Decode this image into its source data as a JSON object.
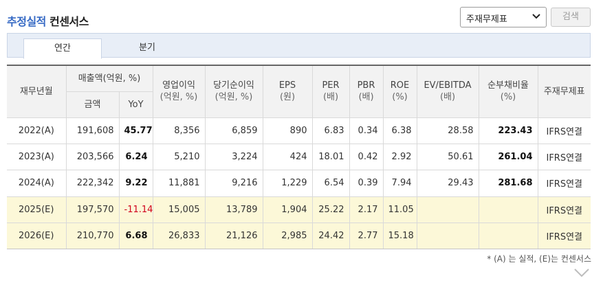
{
  "header": {
    "title_accent": "추정실적",
    "title_rest": "컨센서스",
    "select_value": "주재무제표",
    "search_label": "검색"
  },
  "tabs": [
    {
      "label": "연간",
      "active": true
    },
    {
      "label": "분기",
      "active": false
    }
  ],
  "table": {
    "headers": {
      "period": "재무년월",
      "revenue_group": "매출액(억원, %)",
      "amount": "금액",
      "yoy": "YoY",
      "op_income": "영업이익",
      "op_income_unit": "(억원, %)",
      "net_income": "당기순이익",
      "net_income_unit": "(억원, %)",
      "eps": "EPS",
      "eps_unit": "(원)",
      "per": "PER",
      "per_unit": "(배)",
      "pbr": "PBR",
      "pbr_unit": "(배)",
      "roe": "ROE",
      "roe_unit": "(%)",
      "ev_ebitda": "EV/EBITDA",
      "ev_ebitda_unit": "(배)",
      "net_debt": "순부채비율",
      "net_debt_unit": "(%)",
      "statement": "주재무제표"
    },
    "rows": [
      {
        "period": "2022(A)",
        "amount": "191,608",
        "yoy": "45.77",
        "op": "8,356",
        "net": "6,859",
        "eps": "890",
        "per": "6.83",
        "pbr": "0.34",
        "roe": "6.38",
        "ev": "28.58",
        "debt": "223.43",
        "std": "IFRS연결"
      },
      {
        "period": "2023(A)",
        "amount": "203,566",
        "yoy": "6.24",
        "op": "5,210",
        "net": "3,224",
        "eps": "424",
        "per": "18.01",
        "pbr": "0.42",
        "roe": "2.92",
        "ev": "50.61",
        "debt": "261.04",
        "std": "IFRS연결"
      },
      {
        "period": "2024(A)",
        "amount": "222,342",
        "yoy": "9.22",
        "op": "11,881",
        "net": "9,216",
        "eps": "1,229",
        "per": "6.54",
        "pbr": "0.39",
        "roe": "7.94",
        "ev": "29.43",
        "debt": "281.68",
        "std": "IFRS연결"
      },
      {
        "period": "2025(E)",
        "amount": "197,570",
        "yoy": "-11.14",
        "op": "15,005",
        "net": "13,789",
        "eps": "1,904",
        "per": "25.22",
        "pbr": "2.17",
        "roe": "11.05",
        "ev": "",
        "debt": "",
        "std": "IFRS연결"
      },
      {
        "period": "2026(E)",
        "amount": "210,770",
        "yoy": "6.68",
        "op": "26,833",
        "net": "21,126",
        "eps": "2,985",
        "per": "24.42",
        "pbr": "2.77",
        "roe": "15.18",
        "ev": "",
        "debt": "",
        "std": "IFRS연결"
      }
    ]
  },
  "footnote": "* (A) 는 실적, (E)는 컨센서스",
  "colors": {
    "accent": "#3569c4",
    "negative": "#d0021b",
    "estimate_row_bg": "#fcf8d8",
    "tab_bar_bg": "#e8eef7"
  },
  "icons": {
    "select_chevron": "chevron-down-icon",
    "more": "chevron-down-icon"
  }
}
